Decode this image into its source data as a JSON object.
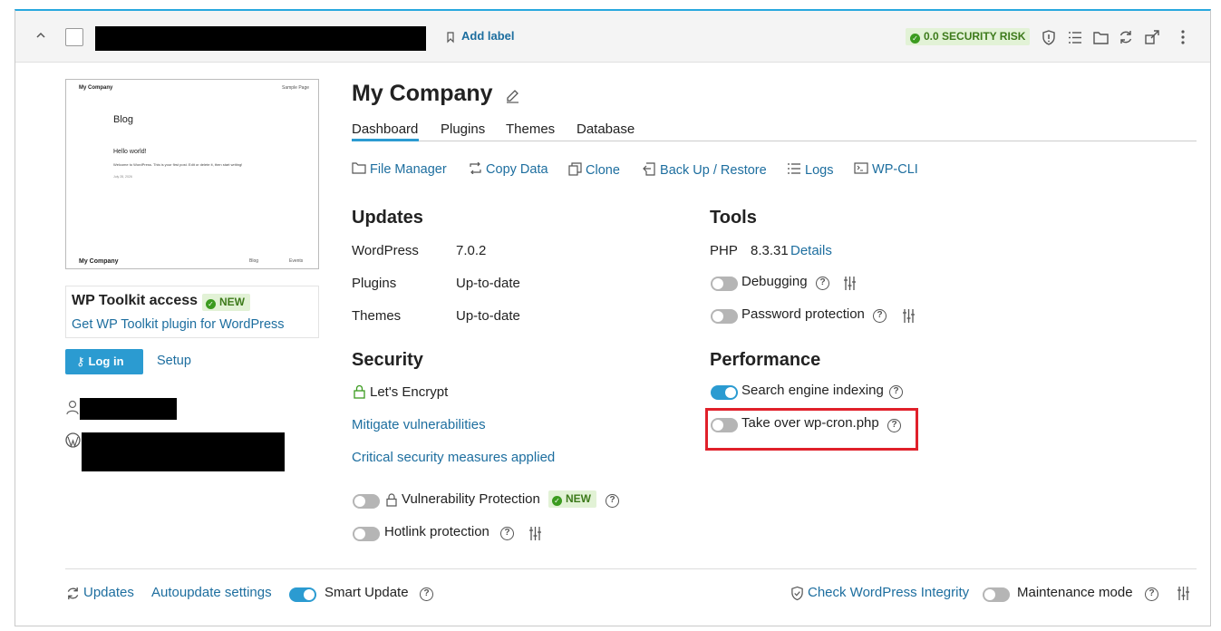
{
  "header": {
    "add_label": "Add label",
    "security_risk": "0.0 SECURITY RISK"
  },
  "thumb": {
    "site_name": "My Company",
    "sample_page": "Sample Page",
    "blog": "Blog",
    "post_title": "Hello world!",
    "post_excerpt": "Welcome to WordPress. This is your first post. Edit or delete it, then start writing!",
    "post_date": "July 28, 2026",
    "footer_name": "My Company",
    "footer_blog": "Blog",
    "footer_events": "Events"
  },
  "toolkit": {
    "title": "WP Toolkit access",
    "new_badge": "NEW",
    "get_plugin": "Get WP Toolkit plugin for WordPress",
    "login": "Log in",
    "setup": "Setup"
  },
  "site": {
    "name": "My Company"
  },
  "tabs": [
    "Dashboard",
    "Plugins",
    "Themes",
    "Database"
  ],
  "quick_actions": [
    "File Manager",
    "Copy Data",
    "Clone",
    "Back Up / Restore",
    "Logs",
    "WP-CLI"
  ],
  "updates": {
    "title": "Updates",
    "rows": [
      {
        "label": "WordPress",
        "value": "7.0.2"
      },
      {
        "label": "Plugins",
        "value": "Up-to-date"
      },
      {
        "label": "Themes",
        "value": "Up-to-date"
      }
    ]
  },
  "security": {
    "title": "Security",
    "ssl": "Let's Encrypt",
    "mitigate": "Mitigate vulnerabilities",
    "critical": "Critical security measures applied",
    "vuln_protection": "Vulnerability Protection",
    "vuln_new": "NEW",
    "hotlink": "Hotlink protection"
  },
  "tools": {
    "title": "Tools",
    "php_label": "PHP",
    "php_version": "8.3.31",
    "details": "Details",
    "debugging": "Debugging",
    "password_protection": "Password protection"
  },
  "performance": {
    "title": "Performance",
    "search_indexing": "Search engine indexing",
    "wp_cron": "Take over wp-cron.php"
  },
  "footer": {
    "updates": "Updates",
    "autoupdate": "Autoupdate settings",
    "smart_update": "Smart Update",
    "check_integrity": "Check WordPress Integrity",
    "maintenance": "Maintenance mode"
  },
  "colors": {
    "accent": "#2b9bd1",
    "link": "#1d6e9f",
    "highlight": "#e0202a",
    "success": "#3b9b1f"
  }
}
